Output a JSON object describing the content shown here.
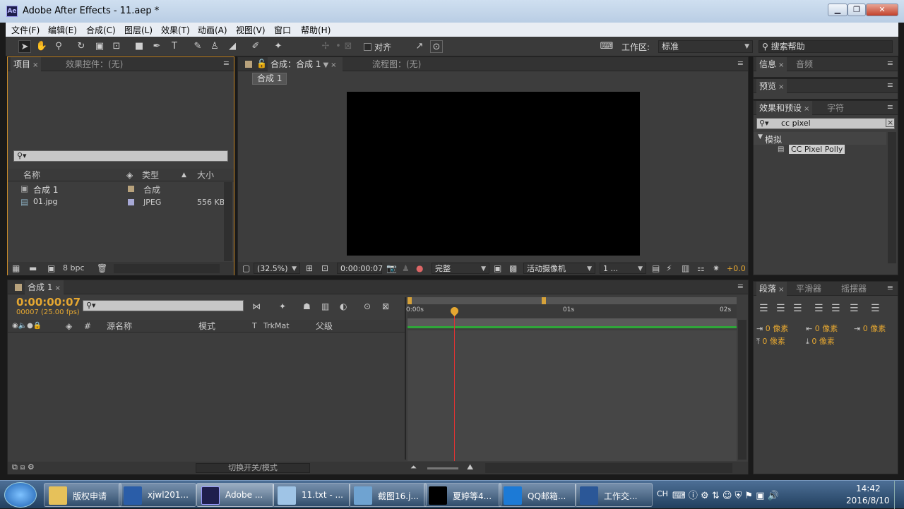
{
  "window": {
    "title": "Adobe After Effects - 11.aep *",
    "app_icon": "Ae"
  },
  "menu": [
    "文件(F)",
    "编辑(E)",
    "合成(C)",
    "图层(L)",
    "效果(T)",
    "动画(A)",
    "视图(V)",
    "窗口",
    "帮助(H)"
  ],
  "toolbar": {
    "snap_label": "对齐",
    "workspace_label": "工作区:",
    "workspace_value": "标准",
    "search_placeholder": "搜索帮助"
  },
  "project_panel": {
    "tabs": [
      "项目",
      "效果控件：(无)"
    ],
    "columns": {
      "name": "名称",
      "type": "类型",
      "size": "大小"
    },
    "items": [
      {
        "name": "合成 1",
        "type": "合成",
        "size": "",
        "label_color": "#b8a27c"
      },
      {
        "name": "01.jpg",
        "type": "JPEG",
        "size": "556 KB",
        "label_color": "#a7a9d6"
      }
    ],
    "bpc": "8 bpc"
  },
  "comp_panel": {
    "tab": "合成：合成 1",
    "flow_tab": "流程图：(无)",
    "breadcrumb": "合成 1",
    "zoom": "(32.5%)",
    "timecode": "0:00:00:07",
    "resolution": "完整",
    "camera": "活动摄像机",
    "views": "1 ...",
    "exposure": "+0.0"
  },
  "right_panels": {
    "info_tabs": [
      "信息",
      "音频"
    ],
    "preview_tab": "预览",
    "effects_tabs": [
      "效果和预设",
      "字符"
    ],
    "effects_search": "cc pixel",
    "category": "模拟",
    "effect_item": "CC Pixel Polly",
    "paragraph_tabs": [
      "段落",
      "平滑器",
      "摇摆器"
    ],
    "indent_values": [
      "0 像素",
      "0 像素",
      "0 像素",
      "0 像素",
      "0 像素"
    ]
  },
  "timeline": {
    "tab": "合成 1",
    "timecode": "0:00:00:07",
    "frame_info": "00007 (25.00 fps)",
    "columns": {
      "hash": "#",
      "source": "源名称",
      "mode": "模式",
      "t": "T",
      "trkmat": "TrkMat",
      "parent": "父级"
    },
    "ruler": [
      "0:00s",
      "01s",
      "02s"
    ],
    "toggle_label": "切换开关/模式"
  },
  "taskbar": {
    "tasks": [
      {
        "label": "版权申请",
        "color": "#e6c15a"
      },
      {
        "label": "xjwl201...",
        "color": "#2a5da8"
      },
      {
        "label": "Adobe ...",
        "color": "#1f1f4d"
      },
      {
        "label": "11.txt - ...",
        "color": "#9fc4e6"
      },
      {
        "label": "截图16.j...",
        "color": "#6fa3d1"
      },
      {
        "label": "夏婷等4...",
        "color": "#000000"
      },
      {
        "label": "QQ邮箱...",
        "color": "#1c7ad6"
      },
      {
        "label": "工作交...",
        "color": "#2b5797"
      }
    ],
    "lang": "CH",
    "time": "14:42",
    "date": "2016/8/10"
  }
}
